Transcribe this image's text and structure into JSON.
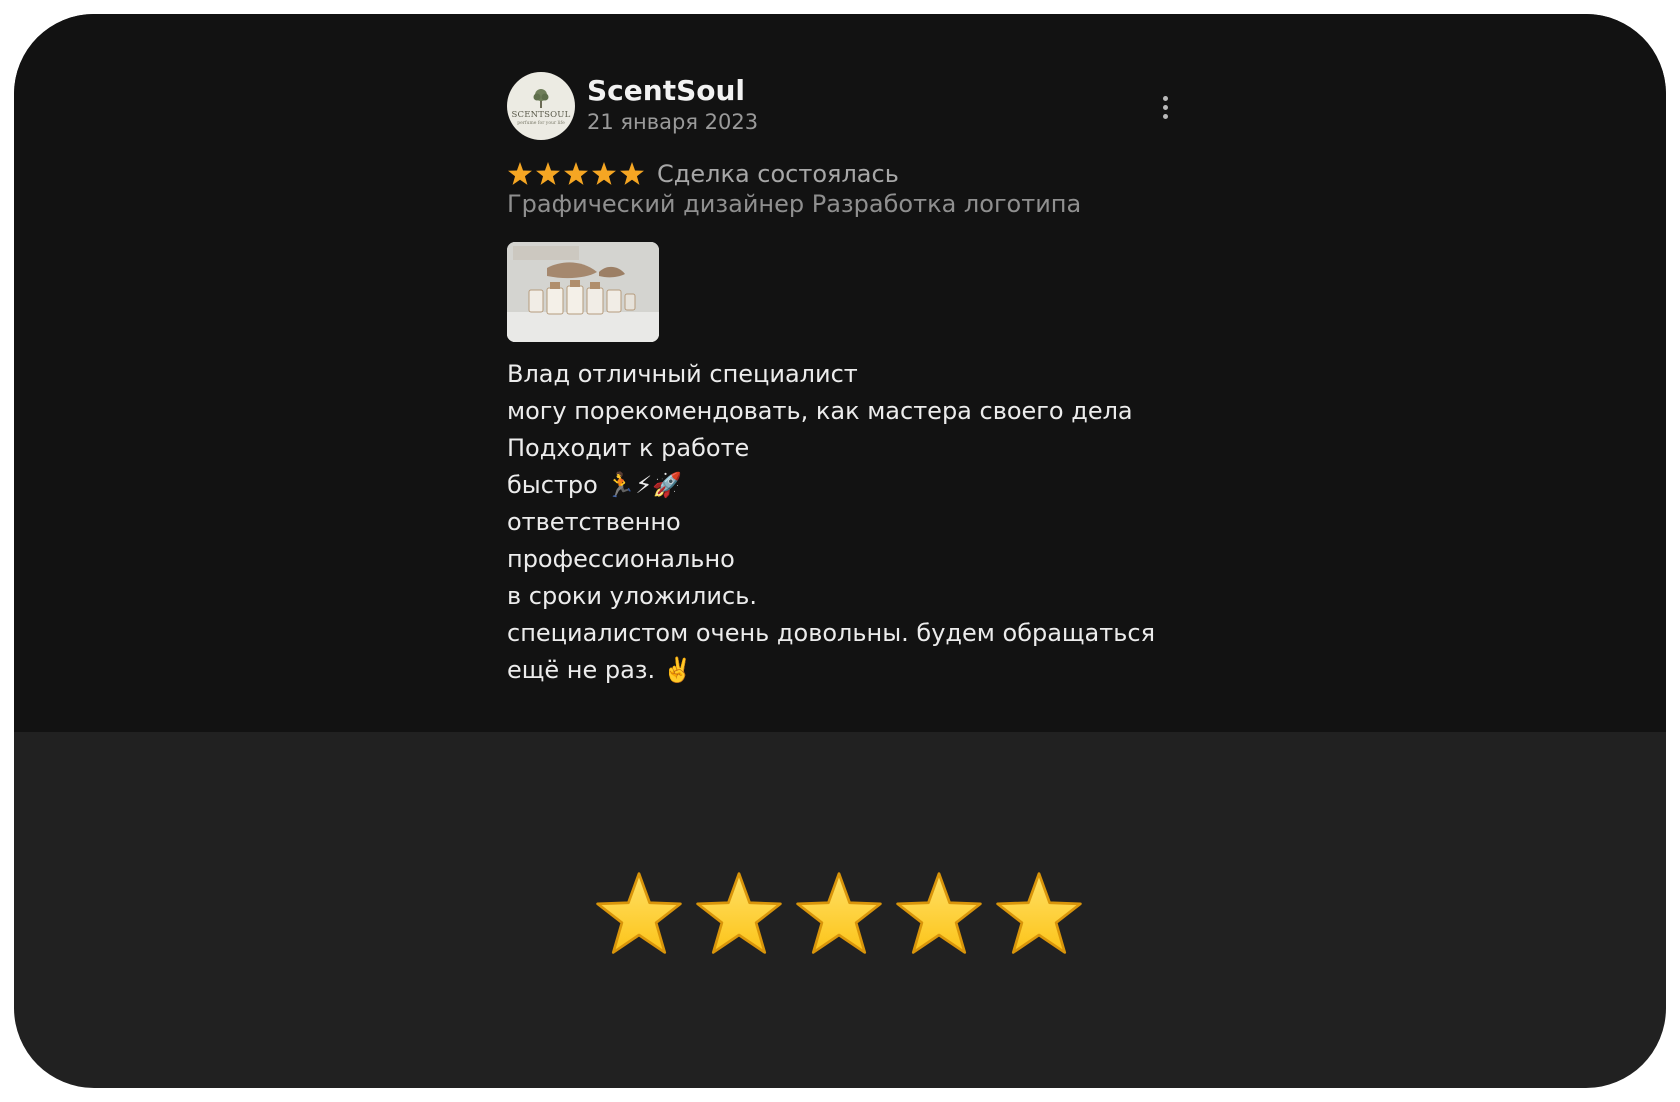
{
  "review": {
    "author": "ScentSoul",
    "avatar_brand": "SCENTSOUL",
    "avatar_tagline": "perfume for your life",
    "date": "21 января 2023",
    "menu_icon": "more-vertical-icon",
    "rating": 5,
    "deal_status": "Сделка состоялась",
    "category": "Графический дизайнер Разработка логотипа",
    "attachment_icon": "photo-thumbnail",
    "text_lines": [
      "Влад отличный специалист",
      "могу порекомендовать, как мастера своего дела",
      "Подходит к работе",
      "быстро 🏃⚡🚀",
      "ответственно",
      "профессионально",
      "в сроки уложились.",
      "специалистом очень довольны. будем обращаться",
      "ещё не раз. ✌️"
    ]
  },
  "big_rating": {
    "value": 5,
    "max": 5
  },
  "colors": {
    "card_top": "#121212",
    "card_bottom": "#212121",
    "star_small": "#f5a623",
    "star_big": "#fcc419"
  }
}
